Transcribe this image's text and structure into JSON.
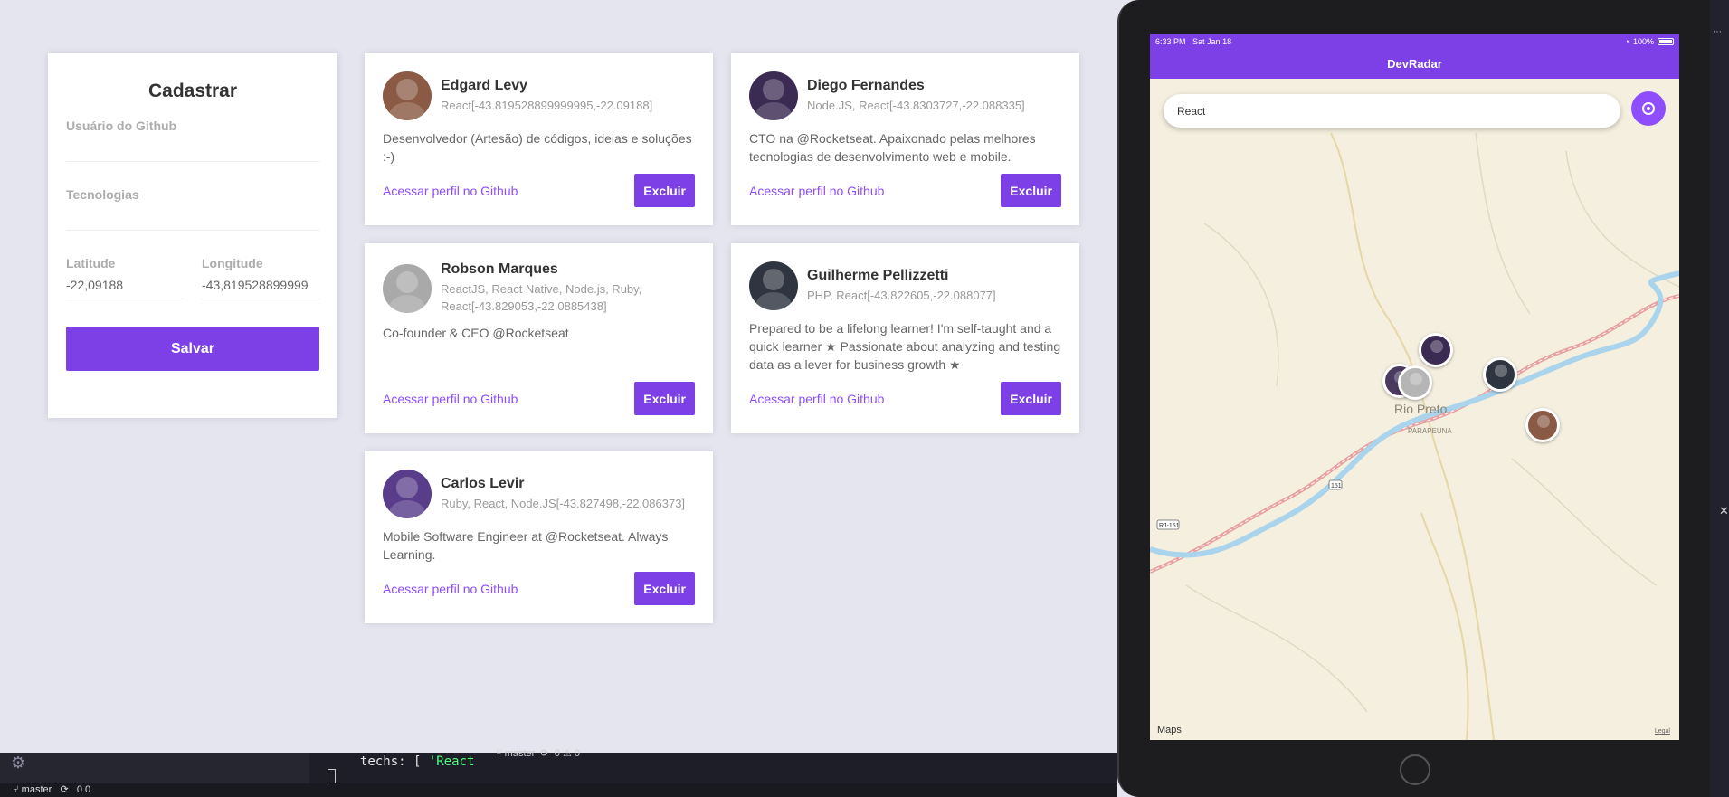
{
  "form": {
    "title": "Cadastrar",
    "github_label": "Usuário do Github",
    "github_value": "",
    "techs_label": "Tecnologias",
    "techs_value": "",
    "latitude_label": "Latitude",
    "latitude_value": "-22,09188",
    "longitude_label": "Longitude",
    "longitude_value": "-43,819528899999",
    "save_label": "Salvar"
  },
  "devs": [
    {
      "name": "Edgard Levy",
      "techs": "React[-43.819528899999995,-22.09188]",
      "bio": "Desenvolvedor (Artesão) de códigos, ideias e soluções :-)",
      "link_label": "Acessar perfil no Github",
      "delete_label": "Excluir",
      "avatar_color": "#8a5a44"
    },
    {
      "name": "Diego Fernandes",
      "techs": "Node.JS, React[-43.8303727,-22.088335]",
      "bio": "CTO na @Rocketseat. Apaixonado pelas melhores tecnologias de desenvolvimento web e mobile.",
      "link_label": "Acessar perfil no Github",
      "delete_label": "Excluir",
      "avatar_color": "#3b2a52"
    },
    {
      "name": "Robson Marques",
      "techs": "ReactJS, React Native, Node.js, Ruby, React[-43.829053,-22.0885438]",
      "bio": "Co-founder & CEO @Rocketseat",
      "link_label": "Acessar perfil no Github",
      "delete_label": "Excluir",
      "avatar_color": "#a9a9a9"
    },
    {
      "name": "Guilherme Pellizzetti",
      "techs": "PHP, React[-43.822605,-22.088077]",
      "bio": "Prepared to be a lifelong learner! I'm self-taught and a quick learner ★ Passionate about analyzing and testing data as a lever for business growth ★",
      "link_label": "Acessar perfil no Github",
      "delete_label": "Excluir",
      "avatar_color": "#2e3440"
    },
    {
      "name": "Carlos Levir",
      "techs": "Ruby, React, Node.JS[-43.827498,-22.086373]",
      "bio": "Mobile Software Engineer at @Rocketseat. Always Learning.",
      "link_label": "Acessar perfil no Github",
      "delete_label": "Excluir",
      "avatar_color": "#5a3d8a"
    }
  ],
  "mobile": {
    "time": "6:33 PM",
    "date": "Sat Jan 18",
    "battery": "100%",
    "nav_title": "DevRadar",
    "search_value": "React",
    "maps_brand": "Maps",
    "legal_label": "Legal",
    "map_labels": {
      "city": "Rio Preto",
      "district": "PARAPEUNA",
      "road_151": "151",
      "road_rj151": "RJ-151"
    }
  },
  "editor": {
    "code_prefix": "techs: [ ",
    "code_string": "'React",
    "branch": "master",
    "status_branch": "master",
    "problems": "0 ⚠ 0",
    "status_problems": "0 0"
  },
  "colors": {
    "brand": "#7d40e7",
    "link": "#8e4dff",
    "background": "#e5e5f0"
  },
  "icons": [
    "gear-icon",
    "location-target-icon",
    "wifi-icon",
    "battery-icon",
    "close-icon",
    "git-branch-icon",
    "sync-icon"
  ]
}
